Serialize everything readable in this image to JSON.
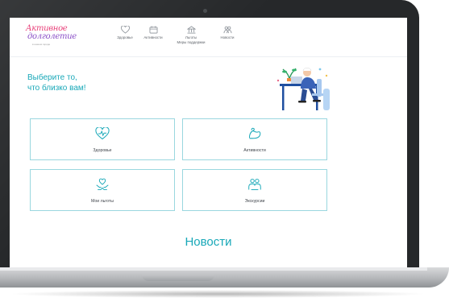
{
  "header": {
    "logo": {
      "line1": "Активное",
      "line2": "долголетие",
      "subtitle": "в нашем городе"
    },
    "nav": [
      {
        "label": "Здоровье",
        "icon": "heart-icon"
      },
      {
        "label": "Активности",
        "icon": "calendar-icon"
      },
      {
        "label": "Льготы",
        "icon": "building-icon",
        "sublabel": "Меры поддержки"
      },
      {
        "label": "Новости",
        "icon": "people-icon"
      }
    ]
  },
  "hero": {
    "title_line1": "Выберите то,",
    "title_line2": "что близко вам!"
  },
  "cards": [
    {
      "label": "Здоровье",
      "icon": "heart-pulse-icon"
    },
    {
      "label": "Активности",
      "icon": "strength-arm-icon"
    },
    {
      "label": "Мои льготы",
      "icon": "hands-heart-icon"
    },
    {
      "label": "Экскурсии",
      "icon": "group-people-icon"
    }
  ],
  "news_heading": "Новости",
  "colors": {
    "accent": "#18a8b8",
    "card_border": "#9ad7df",
    "logo_pink": "#e8417a",
    "logo_purple": "#8a4fc7"
  }
}
